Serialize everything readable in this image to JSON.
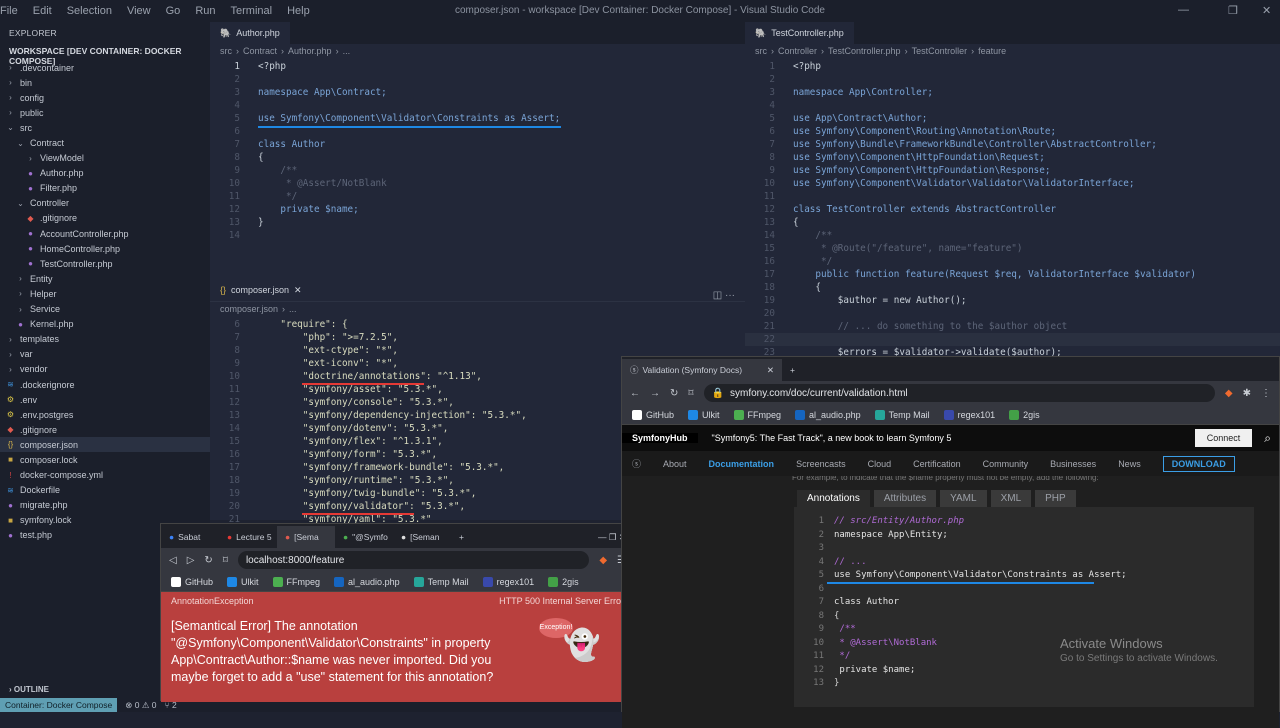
{
  "titlebar": {
    "menu": [
      "File",
      "Edit",
      "Selection",
      "View",
      "Go",
      "Run",
      "Terminal",
      "Help"
    ],
    "title": "composer.json - workspace [Dev Container: Docker Compose] - Visual Studio Code"
  },
  "explorer": {
    "header": "EXPLORER",
    "workspace": "WORKSPACE [DEV CONTAINER: DOCKER COMPOSE]",
    "items": [
      {
        "label": ".devcontainer",
        "kind": "folder",
        "depth": 0
      },
      {
        "label": "bin",
        "kind": "folder",
        "depth": 0
      },
      {
        "label": "config",
        "kind": "folder",
        "depth": 0
      },
      {
        "label": "public",
        "kind": "folder",
        "depth": 0
      },
      {
        "label": "src",
        "kind": "folder-open",
        "depth": 0
      },
      {
        "label": "Contract",
        "kind": "folder-open",
        "depth": 1
      },
      {
        "label": "ViewModel",
        "kind": "folder",
        "depth": 2
      },
      {
        "label": "Author.php",
        "kind": "php",
        "depth": 2
      },
      {
        "label": "Filter.php",
        "kind": "php",
        "depth": 2
      },
      {
        "label": "Controller",
        "kind": "folder-open",
        "depth": 1
      },
      {
        "label": ".gitignore",
        "kind": "git",
        "depth": 2
      },
      {
        "label": "AccountController.php",
        "kind": "php",
        "depth": 2
      },
      {
        "label": "HomeController.php",
        "kind": "php",
        "depth": 2
      },
      {
        "label": "TestController.php",
        "kind": "php",
        "depth": 2
      },
      {
        "label": "Entity",
        "kind": "folder",
        "depth": 1
      },
      {
        "label": "Helper",
        "kind": "folder",
        "depth": 1
      },
      {
        "label": "Service",
        "kind": "folder",
        "depth": 1
      },
      {
        "label": "Kernel.php",
        "kind": "php",
        "depth": 1
      },
      {
        "label": "templates",
        "kind": "folder",
        "depth": 0
      },
      {
        "label": "var",
        "kind": "folder",
        "depth": 0
      },
      {
        "label": "vendor",
        "kind": "folder",
        "depth": 0
      },
      {
        "label": ".dockerignore",
        "kind": "docker",
        "depth": 0
      },
      {
        "label": ".env",
        "kind": "env",
        "depth": 0
      },
      {
        "label": ".env.postgres",
        "kind": "env",
        "depth": 0
      },
      {
        "label": ".gitignore",
        "kind": "git",
        "depth": 0
      },
      {
        "label": "composer.json",
        "kind": "json",
        "depth": 0,
        "selected": true
      },
      {
        "label": "composer.lock",
        "kind": "lock",
        "depth": 0
      },
      {
        "label": "docker-compose.yml",
        "kind": "yml",
        "depth": 0
      },
      {
        "label": "Dockerfile",
        "kind": "docker",
        "depth": 0
      },
      {
        "label": "migrate.php",
        "kind": "php",
        "depth": 0
      },
      {
        "label": "symfony.lock",
        "kind": "lock",
        "depth": 0
      },
      {
        "label": "test.php",
        "kind": "php",
        "depth": 0
      }
    ],
    "outline": "OUTLINE"
  },
  "statusbar": {
    "remote": "Container: Docker Compose",
    "problems": "⊗ 0 ⚠ 0",
    "ports": "⑂ 2"
  },
  "editor1": {
    "tab": "Author.php",
    "breadcrumb": [
      "src",
      "Contract",
      "Author.php",
      "..."
    ],
    "lines": [
      {
        "n": "1",
        "t": "<?php"
      },
      {
        "n": "2",
        "t": ""
      },
      {
        "n": "3",
        "t": "namespace App\\Contract;"
      },
      {
        "n": "4",
        "t": ""
      },
      {
        "n": "5",
        "t": "use Symfony\\Component\\Validator\\Constraints as Assert;"
      },
      {
        "n": "6",
        "t": ""
      },
      {
        "n": "7",
        "t": "class Author"
      },
      {
        "n": "8",
        "t": "{"
      },
      {
        "n": "9",
        "t": "    /**"
      },
      {
        "n": "10",
        "t": "     * @Assert/NotBlank"
      },
      {
        "n": "11",
        "t": "     */"
      },
      {
        "n": "12",
        "t": "    private $name;"
      },
      {
        "n": "13",
        "t": "}"
      },
      {
        "n": "14",
        "t": ""
      }
    ]
  },
  "editor2": {
    "tab": "composer.json",
    "breadcrumb": [
      "composer.json",
      "..."
    ],
    "lines": [
      {
        "n": "6",
        "t": "    \"require\": {"
      },
      {
        "n": "7",
        "t": "        \"php\": \">=7.2.5\","
      },
      {
        "n": "8",
        "t": "        \"ext-ctype\": \"*\","
      },
      {
        "n": "9",
        "t": "        \"ext-iconv\": \"*\","
      },
      {
        "n": "10",
        "t": "        \"doctrine/annotations\": \"^1.13\","
      },
      {
        "n": "11",
        "t": "        \"symfony/asset\": \"5.3.*\","
      },
      {
        "n": "12",
        "t": "        \"symfony/console\": \"5.3.*\","
      },
      {
        "n": "13",
        "t": "        \"symfony/dependency-injection\": \"5.3.*\","
      },
      {
        "n": "14",
        "t": "        \"symfony/dotenv\": \"5.3.*\","
      },
      {
        "n": "15",
        "t": "        \"symfony/flex\": \"^1.3.1\","
      },
      {
        "n": "16",
        "t": "        \"symfony/form\": \"5.3.*\","
      },
      {
        "n": "17",
        "t": "        \"symfony/framework-bundle\": \"5.3.*\","
      },
      {
        "n": "18",
        "t": "        \"symfony/runtime\": \"5.3.*\","
      },
      {
        "n": "19",
        "t": "        \"symfony/twig-bundle\": \"5.3.*\","
      },
      {
        "n": "20",
        "t": "        \"symfony/validator\": \"5.3.*\","
      },
      {
        "n": "21",
        "t": "        \"symfony/yaml\": \"5.3.*\""
      }
    ]
  },
  "editor3": {
    "tab": "TestController.php",
    "breadcrumb": [
      "src",
      "Controller",
      "TestController.php",
      "TestController",
      "feature"
    ],
    "lines": [
      {
        "n": "1",
        "t": "<?php"
      },
      {
        "n": "2",
        "t": ""
      },
      {
        "n": "3",
        "t": "namespace App\\Controller;"
      },
      {
        "n": "4",
        "t": ""
      },
      {
        "n": "5",
        "t": "use App\\Contract\\Author;"
      },
      {
        "n": "6",
        "t": "use Symfony\\Component\\Routing\\Annotation\\Route;"
      },
      {
        "n": "7",
        "t": "use Symfony\\Bundle\\FrameworkBundle\\Controller\\AbstractController;"
      },
      {
        "n": "8",
        "t": "use Symfony\\Component\\HttpFoundation\\Request;"
      },
      {
        "n": "9",
        "t": "use Symfony\\Component\\HttpFoundation\\Response;"
      },
      {
        "n": "10",
        "t": "use Symfony\\Component\\Validator\\Validator\\ValidatorInterface;"
      },
      {
        "n": "11",
        "t": ""
      },
      {
        "n": "12",
        "t": "class TestController extends AbstractController"
      },
      {
        "n": "13",
        "t": "{"
      },
      {
        "n": "14",
        "t": "    /**"
      },
      {
        "n": "15",
        "t": "     * @Route(\"/feature\", name=\"feature\")"
      },
      {
        "n": "16",
        "t": "     */"
      },
      {
        "n": "17",
        "t": "    public function feature(Request $req, ValidatorInterface $validator)"
      },
      {
        "n": "18",
        "t": "    {"
      },
      {
        "n": "19",
        "t": "        $author = new Author();"
      },
      {
        "n": "20",
        "t": ""
      },
      {
        "n": "21",
        "t": "        // ... do something to the $author object"
      },
      {
        "n": "22",
        "t": ""
      },
      {
        "n": "23",
        "t": "        $errors = $validator->validate($author);"
      }
    ]
  },
  "browser1": {
    "tabs": [
      "Sabat",
      "Lecture 5",
      "[Sema",
      "\"@Symfo",
      "[Seman"
    ],
    "url": "localhost:8000/feature",
    "bookmarks": [
      "GitHub",
      "Ulkit",
      "FFmpeg",
      "al_audio.php",
      "Temp Mail",
      "regex101",
      "2gis"
    ],
    "exception": "AnnotationException",
    "http": "HTTP 500 Internal Server Error",
    "message": "[Semantical Error] The annotation \"@Symfony\\Component\\Validator\\Constraints\" in property App\\Contract\\Author::$name was never imported. Did you maybe forget to add a \"use\" statement for this annotation?",
    "badge": "Exception!"
  },
  "browser2": {
    "tab": "Validation (Symfony Docs)",
    "url": "symfony.com/doc/current/validation.html",
    "bookmarks": [
      "GitHub",
      "Ulkit",
      "FFmpeg",
      "al_audio.php",
      "Temp Mail",
      "regex101",
      "2gis"
    ],
    "hub": "SymfonyHub",
    "promo": "\"Symfony5: The Fast Track\", a new book to learn Symfony 5",
    "connect": "Connect",
    "nav": [
      "About",
      "Documentation",
      "Screencasts",
      "Cloud",
      "Certification",
      "Community",
      "Businesses",
      "News"
    ],
    "download": "DOWNLOAD",
    "cut_text": "For example, to indicate that the $name property must not be empty, add the following:",
    "code_tabs": [
      "Annotations",
      "Attributes",
      "YAML",
      "XML",
      "PHP"
    ],
    "code": [
      {
        "n": "1",
        "t": "// src/Entity/Author.php"
      },
      {
        "n": "2",
        "t": "namespace App\\Entity;"
      },
      {
        "n": "3",
        "t": ""
      },
      {
        "n": "4",
        "t": "// ..."
      },
      {
        "n": "5",
        "t": "use Symfony\\Component\\Validator\\Constraints as Assert;"
      },
      {
        "n": "6",
        "t": ""
      },
      {
        "n": "7",
        "t": "class Author"
      },
      {
        "n": "8",
        "t": "{"
      },
      {
        "n": "9",
        "t": "    /**"
      },
      {
        "n": "10",
        "t": "     * @Assert\\NotBlank"
      },
      {
        "n": "11",
        "t": "     */"
      },
      {
        "n": "12",
        "t": "    private $name;"
      },
      {
        "n": "13",
        "t": "}"
      }
    ],
    "watermark1": "Activate Windows",
    "watermark2": "Go to Settings to activate Windows."
  },
  "colors": {
    "accent": "#1e88e5",
    "underline_red": "#e53935",
    "error_bg": "#b9403e"
  }
}
